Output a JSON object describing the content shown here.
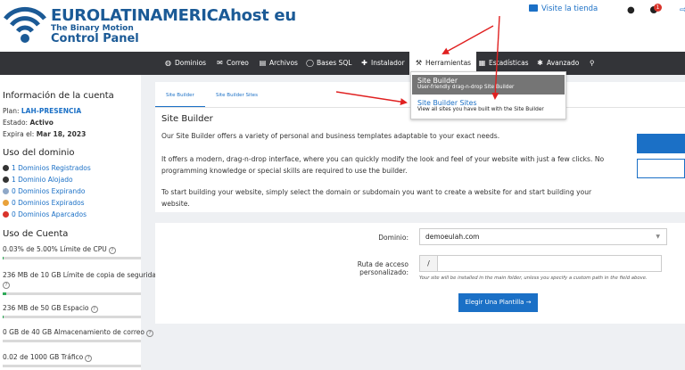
{
  "brand": {
    "name": "EUROLATINAMERICAhost eu",
    "tagline": "The Binary Motion",
    "product": "Control Panel"
  },
  "topbar": {
    "visit_store": "Visite la tienda",
    "notification_count": "1",
    "icons": [
      "store-icon",
      "bell-icon",
      "user-icon",
      "logout-icon"
    ]
  },
  "nav": {
    "items": [
      {
        "label": "Dominios",
        "icon": "globe-icon",
        "glyph": "◍"
      },
      {
        "label": "Correo",
        "icon": "envelope-icon",
        "glyph": "✉"
      },
      {
        "label": "Archivos",
        "icon": "files-icon",
        "glyph": "▤"
      },
      {
        "label": "Bases SQL",
        "icon": "database-icon",
        "glyph": "◯"
      },
      {
        "label": "Instalador",
        "icon": "puzzle-icon",
        "glyph": "✚"
      },
      {
        "label": "Herramientas",
        "icon": "wrench-icon",
        "glyph": "🔧"
      },
      {
        "label": "Estadísticas",
        "icon": "chart-icon",
        "glyph": "▦"
      },
      {
        "label": "Avanzado",
        "icon": "gear-icon",
        "glyph": "✱"
      }
    ],
    "active_item": "Herramientas",
    "search_icon": "search-icon"
  },
  "dropdown": {
    "items": [
      {
        "title": "Site Builder",
        "subtitle": "User-friendly drag-n-drop Site Builder"
      },
      {
        "title": "Site Builder Sites",
        "subtitle": "View all sites you have built with the Site Builder"
      }
    ]
  },
  "sidebar": {
    "account_heading": "Información de la cuenta",
    "plan_label": "Plan:",
    "plan_value": "LAH-PRESENCIA",
    "status_label": "Estado:",
    "status_value": "Activo",
    "expiry_label": "Expira el:",
    "expiry_value": "Mar 18, 2023",
    "domain_heading": "Uso del dominio",
    "domains": [
      {
        "text": "1 Dominios Registrados",
        "color": "#333333"
      },
      {
        "text": "1 Dominio Alojado",
        "color": "#333333"
      },
      {
        "text": "0 Dominios Expirando",
        "color": "#8fa8c8"
      },
      {
        "text": "0 Dominios Expirados",
        "color": "#e9a23b"
      },
      {
        "text": "0 Dominios Aparcados",
        "color": "#d9342b"
      }
    ],
    "usage_heading": "Uso de Cuenta",
    "usage": [
      {
        "text": "0.03% de 5.00% Límite de CPU",
        "fill": 0.006
      },
      {
        "text": "236 MB de 10 GB Límite de copia de seguridad",
        "fill": 0.023
      },
      {
        "text": "236 MB de 50 GB Espacio",
        "fill": 0.005
      },
      {
        "text": "0 GB de 40 GB Almacenamiento de correo",
        "fill": 0.0
      },
      {
        "text": "0.02 de 1000 GB Tráfico",
        "fill": 0.0
      }
    ]
  },
  "main": {
    "tabs": [
      "Site Builder",
      "Site Builder Sites"
    ],
    "active_tab": "Site Builder",
    "title": "Site Builder",
    "paragraphs": [
      "Our Site Builder offers a variety of personal and business templates adaptable to your exact needs.",
      "It offers a modern, drag-n-drop interface, where you can quickly modify the look and feel of your website with just a few clicks. No programming knowledge or special skills are required to use the builder.",
      "To start building your website, simply select the domain or subdomain you want to create a website for and start building your website."
    ],
    "form": {
      "domain_label": "Dominio:",
      "domain_value": "demoeulah.com",
      "path_label": "Ruta de acceso personalizado:",
      "path_prefix": "/",
      "path_value": "",
      "hint": "Your site will be installed in the main folder, unless you specify a custom path in the field above.",
      "submit_label": "Elegir Una Plantilla →"
    }
  },
  "colors": {
    "brand_blue": "#1b5a96",
    "link_blue": "#1b70c6",
    "nav_bg": "#333438",
    "annotation_red": "#e02020"
  }
}
